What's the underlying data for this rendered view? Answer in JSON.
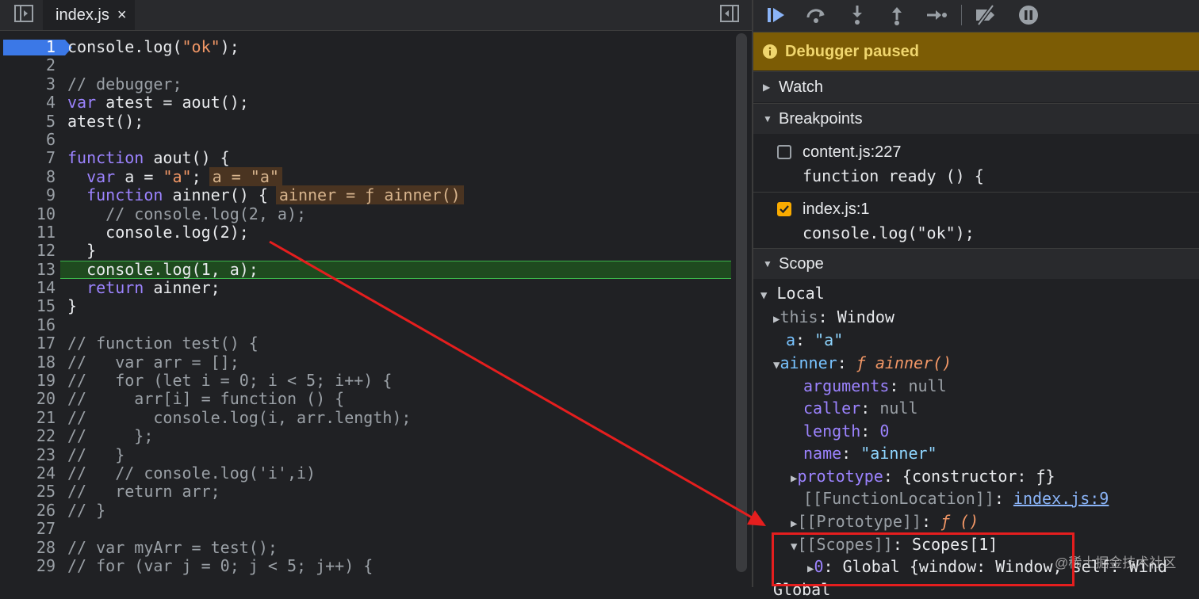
{
  "editor": {
    "tab_name": "index.js",
    "tab_close": "×",
    "lines": [
      {
        "n": "1",
        "text": "console.log(\"ok\");"
      },
      {
        "n": "2",
        "text": ""
      },
      {
        "n": "3",
        "text": "// debugger;"
      },
      {
        "n": "4",
        "text": "var atest = aout();"
      },
      {
        "n": "5",
        "text": "atest();"
      },
      {
        "n": "6",
        "text": ""
      },
      {
        "n": "7",
        "text": "function aout() {"
      },
      {
        "n": "8",
        "text": "  var a = \"a\";",
        "inline": "a = \"a\""
      },
      {
        "n": "9",
        "text": "  function ainner() {",
        "inline": "ainner = ƒ ainner()"
      },
      {
        "n": "10",
        "text": "    // console.log(2, a);"
      },
      {
        "n": "11",
        "text": "    console.log(2);"
      },
      {
        "n": "12",
        "text": "  }"
      },
      {
        "n": "13",
        "text": "  console.log(1, a);"
      },
      {
        "n": "14",
        "text": "  return ainner;"
      },
      {
        "n": "15",
        "text": "}"
      },
      {
        "n": "16",
        "text": ""
      },
      {
        "n": "17",
        "text": "// function test() {"
      },
      {
        "n": "18",
        "text": "//   var arr = [];"
      },
      {
        "n": "19",
        "text": "//   for (let i = 0; i < 5; i++) {"
      },
      {
        "n": "20",
        "text": "//     arr[i] = function () {"
      },
      {
        "n": "21",
        "text": "//       console.log(i, arr.length);"
      },
      {
        "n": "22",
        "text": "//     };"
      },
      {
        "n": "23",
        "text": "//   }"
      },
      {
        "n": "24",
        "text": "//   // console.log('i',i)"
      },
      {
        "n": "25",
        "text": "//   return arr;"
      },
      {
        "n": "26",
        "text": "// }"
      },
      {
        "n": "27",
        "text": ""
      },
      {
        "n": "28",
        "text": "// var myArr = test();"
      },
      {
        "n": "29",
        "text": "// for (var j = 0; j < 5; j++) {"
      }
    ],
    "current_line": "13",
    "breakpoint_line": "1"
  },
  "sidebar": {
    "paused_text": "Debugger paused",
    "watch_label": "Watch",
    "breakpoints_label": "Breakpoints",
    "breakpoints": [
      {
        "file": "content.js:227",
        "code": "function ready () {",
        "checked": false
      },
      {
        "file": "index.js:1",
        "code": "console.log(\"ok\");",
        "checked": true
      }
    ],
    "scope_label": "Scope",
    "local_label": "Local",
    "this_key": "this",
    "this_val": "Window",
    "a_key": "a",
    "a_val": "\"a\"",
    "ainner_key": "ainner",
    "ainner_val": "ƒ ainner()",
    "arguments_key": "arguments",
    "arguments_val": "null",
    "caller_key": "caller",
    "caller_val": "null",
    "length_key": "length",
    "length_val": "0",
    "name_key": "name",
    "name_val": "\"ainner\"",
    "prototype_key": "prototype",
    "prototype_val": "{constructor: ƒ}",
    "funcloc_key": "[[FunctionLocation]]",
    "funcloc_val": "index.js:9",
    "proto_key": "[[Prototype]]",
    "proto_val": "ƒ ()",
    "scopes_key": "[[Scopes]]",
    "scopes_val": "Scopes[1]",
    "scope0_key": "0",
    "scope0_val": "Global {window: Window, self: Wind",
    "global_label": "Global"
  },
  "watermark": "@稀土掘金技术社区",
  "colors": {
    "paused_bg": "#7c5c05",
    "annotation_red": "#e51e1e",
    "current_line_bg": "#1f4a1f",
    "breakpoint_blue": "#3b78e7"
  }
}
